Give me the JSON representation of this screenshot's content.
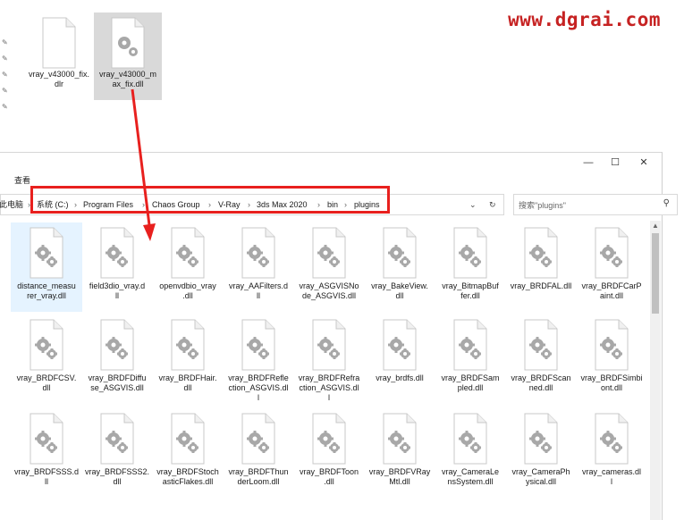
{
  "watermark": "www.dgrai.com",
  "top_files": [
    {
      "name": "vray_v43000_fix.dlr",
      "line1": "vray_v43000_fix.",
      "line2": "dlr"
    },
    {
      "name": "vray_v43000_max_fix.dll",
      "line1": "vray_v43000_m",
      "line2": "ax_fix.dll"
    }
  ],
  "window": {
    "minimize": "—",
    "maximize": "☐",
    "close": "✕",
    "ribbon_tab": "查看"
  },
  "address_bar": {
    "prefix": "此电脑",
    "crumbs": [
      "系统 (C:)",
      "Program Files",
      "Chaos Group",
      "V-Ray",
      "3ds Max 2020",
      "bin",
      "plugins"
    ],
    "separator": "›",
    "dropdown": "⌄",
    "refresh": "↻"
  },
  "search": {
    "placeholder": "搜索\"plugins\"",
    "icon": "⚲"
  },
  "files": [
    {
      "l1": "distance_measu",
      "l2": "rer_vray.dll",
      "l3": ""
    },
    {
      "l1": "field3dio_vray.d",
      "l2": "ll",
      "l3": ""
    },
    {
      "l1": "openvdbio_vray",
      "l2": ".dll",
      "l3": ""
    },
    {
      "l1": "vray_AAFilters.d",
      "l2": "ll",
      "l3": ""
    },
    {
      "l1": "vray_ASGVISNo",
      "l2": "de_ASGVIS.dll",
      "l3": ""
    },
    {
      "l1": "vray_BakeView.",
      "l2": "dll",
      "l3": ""
    },
    {
      "l1": "vray_BitmapBuf",
      "l2": "fer.dll",
      "l3": ""
    },
    {
      "l1": "vray_BRDFAL.dll",
      "l2": "",
      "l3": ""
    },
    {
      "l1": "vray_BRDFCarP",
      "l2": "aint.dll",
      "l3": ""
    },
    {
      "l1": "vray_BRDFCSV.",
      "l2": "dll",
      "l3": ""
    },
    {
      "l1": "vray_BRDFDiffu",
      "l2": "se_ASGVIS.dll",
      "l3": ""
    },
    {
      "l1": "vray_BRDFHair.",
      "l2": "dll",
      "l3": ""
    },
    {
      "l1": "vray_BRDFRefle",
      "l2": "ction_ASGVIS.dl",
      "l3": "l"
    },
    {
      "l1": "vray_BRDFRefra",
      "l2": "ction_ASGVIS.dl",
      "l3": "l"
    },
    {
      "l1": "vray_brdfs.dll",
      "l2": "",
      "l3": ""
    },
    {
      "l1": "vray_BRDFSam",
      "l2": "pled.dll",
      "l3": ""
    },
    {
      "l1": "vray_BRDFScan",
      "l2": "ned.dll",
      "l3": ""
    },
    {
      "l1": "vray_BRDFSimbi",
      "l2": "ont.dll",
      "l3": ""
    },
    {
      "l1": "vray_BRDFSSS.d",
      "l2": "ll",
      "l3": ""
    },
    {
      "l1": "vray_BRDFSSS2.",
      "l2": "dll",
      "l3": ""
    },
    {
      "l1": "vray_BRDFStoch",
      "l2": "asticFlakes.dll",
      "l3": ""
    },
    {
      "l1": "vray_BRDFThun",
      "l2": "derLoom.dll",
      "l3": ""
    },
    {
      "l1": "vray_BRDFToon",
      "l2": ".dll",
      "l3": ""
    },
    {
      "l1": "vray_BRDFVRay",
      "l2": "Mtl.dll",
      "l3": ""
    },
    {
      "l1": "vray_CameraLe",
      "l2": "nsSystem.dll",
      "l3": ""
    },
    {
      "l1": "vray_CameraPh",
      "l2": "ysical.dll",
      "l3": ""
    },
    {
      "l1": "vray_cameras.dl",
      "l2": "l",
      "l3": ""
    }
  ],
  "colors": {
    "highlight_box": "#e8201e",
    "selected_bg": "#e5f3ff",
    "watermark": "#c62222"
  }
}
